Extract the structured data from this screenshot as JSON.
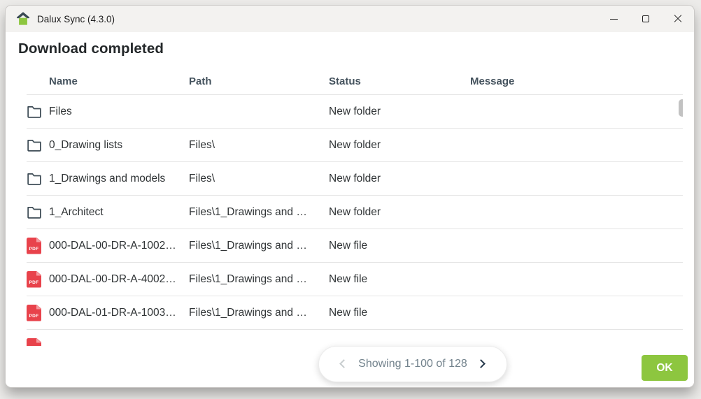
{
  "window": {
    "title": "Dalux Sync (4.3.0)",
    "icons": [
      "dalux-home-logo",
      "minimize-icon",
      "maximize-icon",
      "close-icon"
    ]
  },
  "heading": "Download completed",
  "table": {
    "columns": [
      "Name",
      "Path",
      "Status",
      "Message"
    ],
    "rows": [
      {
        "icon": "folder",
        "name": "Files",
        "path": "",
        "status": "New folder",
        "message": ""
      },
      {
        "icon": "folder",
        "name": "0_Drawing lists",
        "path": "Files\\",
        "status": "New folder",
        "message": ""
      },
      {
        "icon": "folder",
        "name": "1_Drawings and models",
        "path": "Files\\",
        "status": "New folder",
        "message": ""
      },
      {
        "icon": "folder",
        "name": "1_Architect",
        "path": "Files\\1_Drawings and …",
        "status": "New folder",
        "message": ""
      },
      {
        "icon": "pdf",
        "name": "000-DAL-00-DR-A-1002…",
        "path": "Files\\1_Drawings and …",
        "status": "New file",
        "message": ""
      },
      {
        "icon": "pdf",
        "name": "000-DAL-00-DR-A-4002…",
        "path": "Files\\1_Drawings and …",
        "status": "New file",
        "message": ""
      },
      {
        "icon": "pdf",
        "name": "000-DAL-01-DR-A-1003…",
        "path": "Files\\1_Drawings and …",
        "status": "New file",
        "message": ""
      },
      {
        "icon": "pdf",
        "name": "",
        "path": "",
        "status": "",
        "message": ""
      }
    ],
    "pdf_icon_label": "PDF"
  },
  "pagination": {
    "label": "Showing 1-100 of 128"
  },
  "footer": {
    "ok_label": "OK"
  },
  "colors": {
    "accent_green": "#8dc63f",
    "pdf_red": "#e8424b",
    "header_text": "#44525d",
    "row_text": "#303436",
    "titlebar_bg": "#f3f2f0"
  }
}
